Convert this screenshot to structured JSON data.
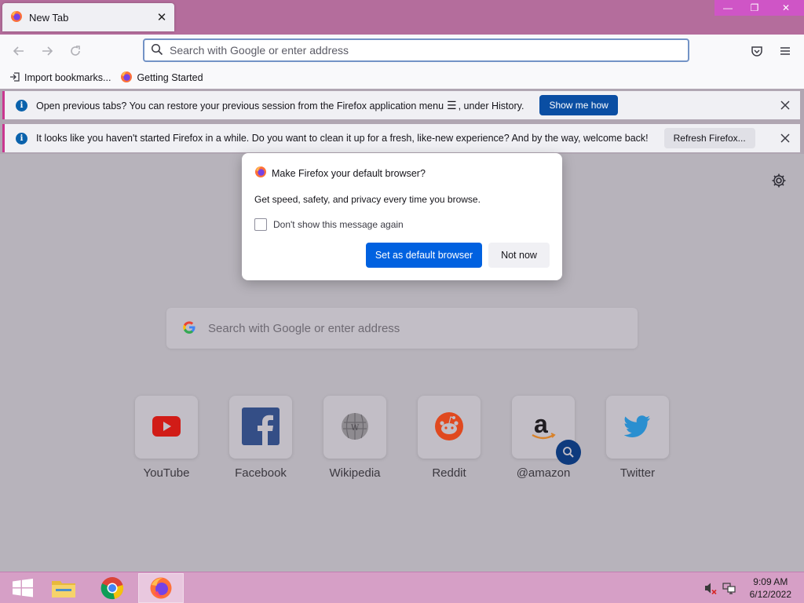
{
  "window": {
    "tab_title": "New Tab",
    "controls": {
      "minimize": "—",
      "restore": "❐",
      "close": "✕"
    }
  },
  "toolbar": {
    "url_placeholder": "Search with Google or enter address",
    "icons": [
      "back-arrow-icon",
      "forward-arrow-icon",
      "reload-icon",
      "pocket-icon",
      "hamburger-menu-icon"
    ]
  },
  "bookmarks": [
    {
      "label": "Import bookmarks...",
      "icon": "import-icon"
    },
    {
      "label": "Getting Started",
      "icon": "firefox-icon"
    }
  ],
  "notifications": [
    {
      "text_before": "Open previous tabs? You can restore your previous session from the Firefox application menu",
      "text_after": ", under History.",
      "button": "Show me how"
    },
    {
      "text": "It looks like you haven't started Firefox in a while. Do you want to clean it up for a fresh, like-new experience? And by the way, welcome back!",
      "button": "Refresh Firefox..."
    }
  ],
  "new_tab": {
    "search_placeholder": "Search with Google or enter address",
    "shortcuts": [
      {
        "label": "YouTube",
        "icon": "youtube-icon"
      },
      {
        "label": "Facebook",
        "icon": "facebook-icon"
      },
      {
        "label": "Wikipedia",
        "icon": "wikipedia-icon"
      },
      {
        "label": "Reddit",
        "icon": "reddit-icon"
      },
      {
        "label": "@amazon",
        "icon": "amazon-icon"
      },
      {
        "label": "Twitter",
        "icon": "twitter-icon"
      }
    ]
  },
  "dialog": {
    "title": "Make Firefox your default browser?",
    "body": "Get speed, safety, and privacy every time you browse.",
    "checkbox_label": "Don't show this message again",
    "checkbox_checked": false,
    "primary_button": "Set as default browser",
    "secondary_button": "Not now"
  },
  "taskbar": {
    "apps": [
      "windows-start-icon",
      "file-explorer-icon",
      "chrome-icon",
      "firefox-icon"
    ],
    "active_app": "firefox-icon",
    "time": "9:09 AM",
    "date": "6/12/2022"
  },
  "colors": {
    "accent_blue": "#0061e0",
    "infobar_button": "#0a4ea3",
    "titlebar": "#b46d9c",
    "taskbar": "#d69fc6",
    "notification_stripe": "#c9368f"
  }
}
